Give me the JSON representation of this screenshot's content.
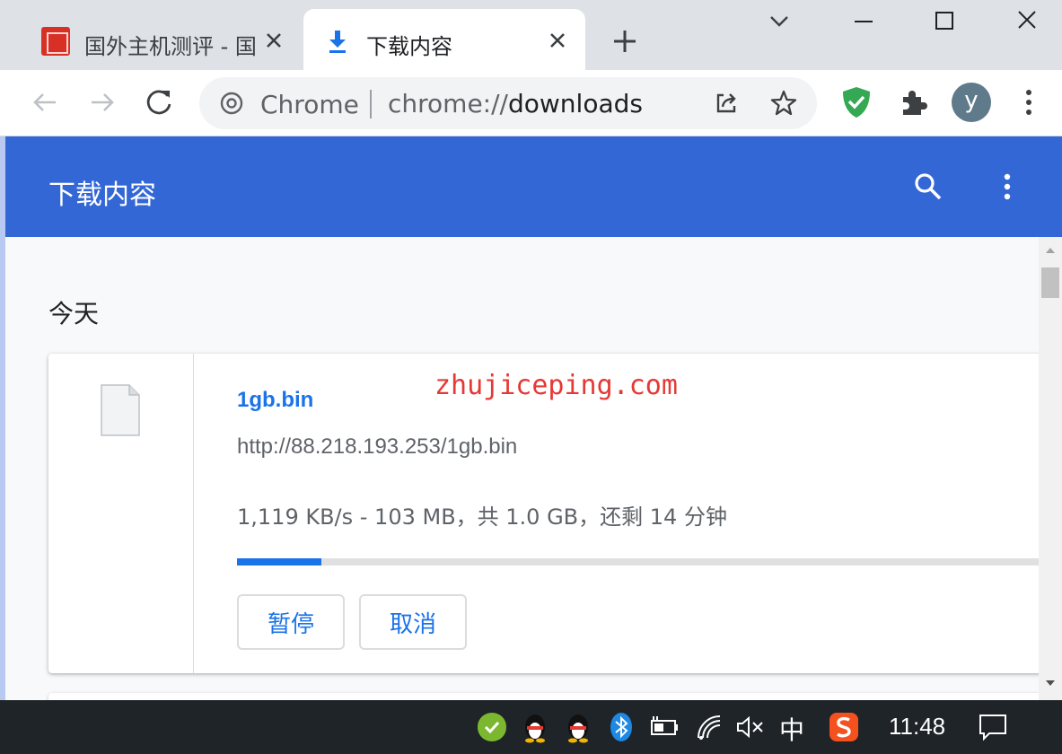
{
  "tabs": [
    {
      "title": "国外主机测评 - 国",
      "active": false,
      "favicon": "site-logo-icon"
    },
    {
      "title": "下载内容",
      "active": true,
      "favicon": "download-icon"
    }
  ],
  "toolbar": {
    "chip": "Chrome",
    "url_scheme": "chrome://",
    "url_host": "downloads",
    "avatar_letter": "y"
  },
  "downloads": {
    "title": "下载内容",
    "section": "今天",
    "items": [
      {
        "file_name": "1gb.bin",
        "url": "http://88.218.193.253/1gb.bin",
        "status": "1,119 KB/s - 103 MB，共 1.0 GB，还剩 14 分钟",
        "progress_fraction": 0.103,
        "pause_label": "暂停",
        "cancel_label": "取消"
      }
    ]
  },
  "watermark": "zhujiceping.com",
  "taskbar": {
    "ime": "中",
    "clock": "11:48"
  },
  "colors": {
    "header_blue": "#3367d6",
    "link_blue": "#1a73e8",
    "watermark_red": "#e53935"
  }
}
